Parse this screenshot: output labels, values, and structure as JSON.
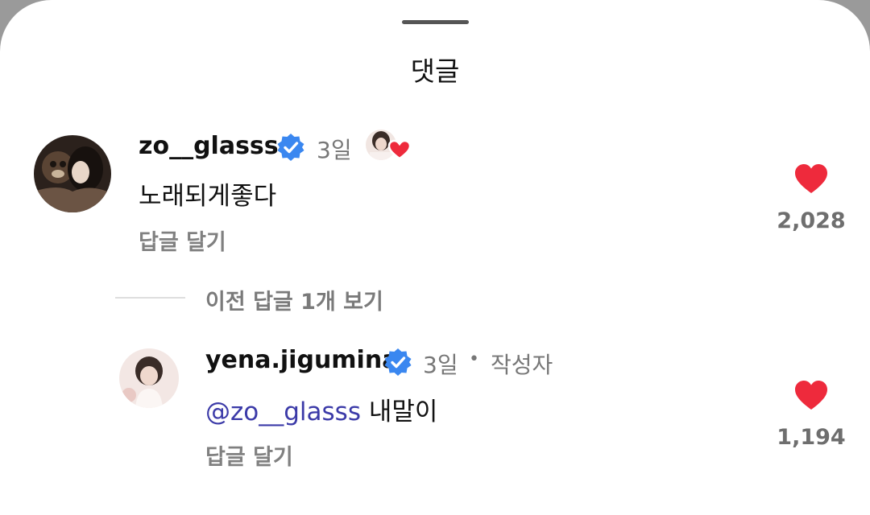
{
  "header": {
    "title": "댓글"
  },
  "comments": [
    {
      "username": "zo__glasss",
      "time": "3일",
      "text": "노래되게좋다",
      "reply_label": "답글 달기",
      "like_count": "2,028",
      "author_liked": true
    }
  ],
  "view_prev_replies": "이전 답글 1개 보기",
  "replies": [
    {
      "username": "yena.jigumina",
      "time": "3일",
      "separator": "•",
      "author_badge": "작성자",
      "mention": "@zo__glasss",
      "text": "내말이",
      "reply_label": "답글 달기",
      "like_count": "1,194"
    }
  ],
  "colors": {
    "heart": "#ee2a3c",
    "verified": "#3a87f0",
    "mention": "#3b3aa8"
  }
}
